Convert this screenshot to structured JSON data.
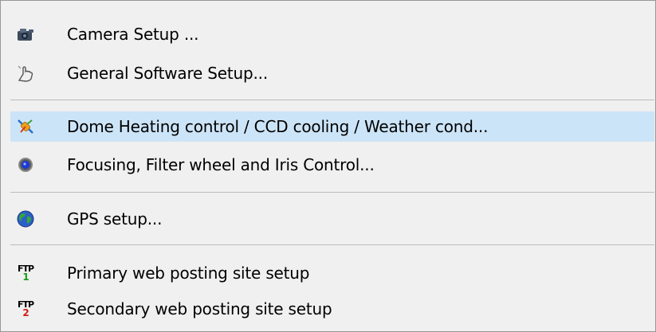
{
  "menu": {
    "items": [
      {
        "label": "Camera Setup ...",
        "icon": "camera-icon"
      },
      {
        "label": "General Software Setup...",
        "icon": "hand-pointer-icon"
      },
      {
        "label": "Dome Heating control / CCD cooling / Weather cond...",
        "icon": "plug-icon"
      },
      {
        "label": "Focusing, Filter wheel and Iris Control...",
        "icon": "lens-icon"
      },
      {
        "label": "GPS setup...",
        "icon": "globe-icon"
      },
      {
        "label": "Primary web posting site setup",
        "icon": "ftp-1-icon"
      },
      {
        "label": "Secondary web posting site setup",
        "icon": "ftp-2-icon"
      }
    ],
    "highlighted_index": 2,
    "ftp_icon_text": "FTP",
    "ftp_icon_num_1": "1",
    "ftp_icon_num_2": "2"
  },
  "colors": {
    "background": "#f0f0f0",
    "highlight": "#cce4f7",
    "separator": "#bcbcbc",
    "border": "#979797"
  }
}
